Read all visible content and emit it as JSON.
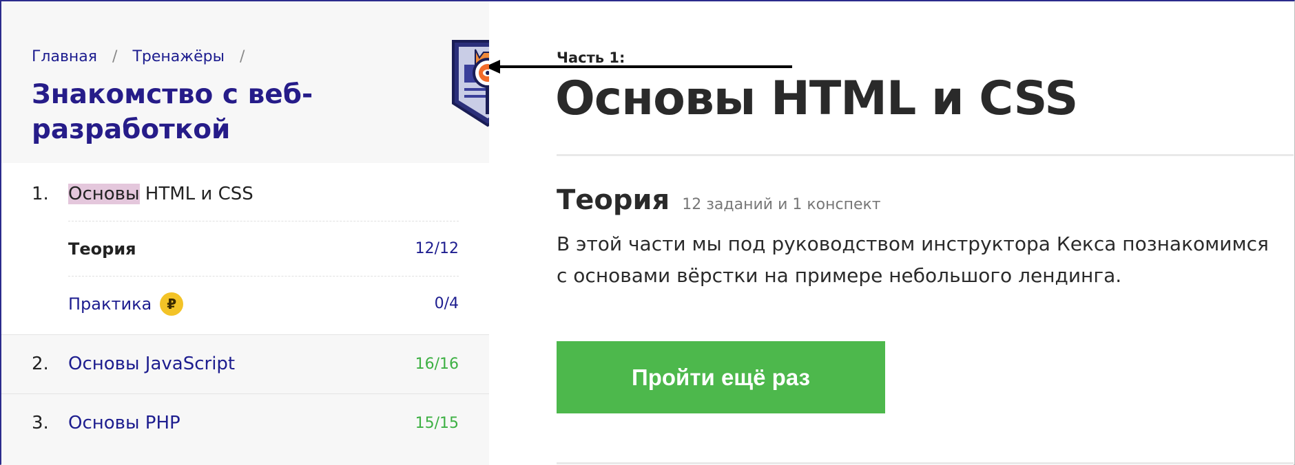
{
  "breadcrumb": {
    "home": "Главная",
    "trainers": "Тренажёры",
    "sep": "/"
  },
  "course": {
    "title": "Знакомство с веб-разработкой"
  },
  "modules": [
    {
      "num": "1.",
      "title_highlight": "Основы",
      "title_rest": " HTML и CSS",
      "sub": [
        {
          "label": "Теория",
          "count": "12/12"
        },
        {
          "label": "Практика",
          "count": "0/4",
          "coin": "₽"
        }
      ]
    },
    {
      "num": "2.",
      "title": "Основы JavaScript",
      "count": "16/16"
    },
    {
      "num": "3.",
      "title": "Основы PHP",
      "count": "15/15"
    }
  ],
  "main": {
    "part_label": "Часть 1:",
    "part_title": "Основы HTML и CSS",
    "theory_title": "Теория",
    "theory_meta": "12 заданий и 1 конспект",
    "description": "В этой части мы под руководством инструктора Кекса познакомимся с основами вёрстки на примере небольшого лендинга.",
    "cta": "Пройти ещё раз"
  },
  "colors": {
    "link": "#1d1d8f",
    "title": "#261c89",
    "success": "#3db043",
    "button": "#4db84c",
    "highlight": "#e4c7dc",
    "coin": "#f3c327"
  },
  "icons": {
    "badge": "cat-detective-badge-icon",
    "coin": "ruble-coin-icon",
    "arrow": "arrow-left-icon"
  }
}
